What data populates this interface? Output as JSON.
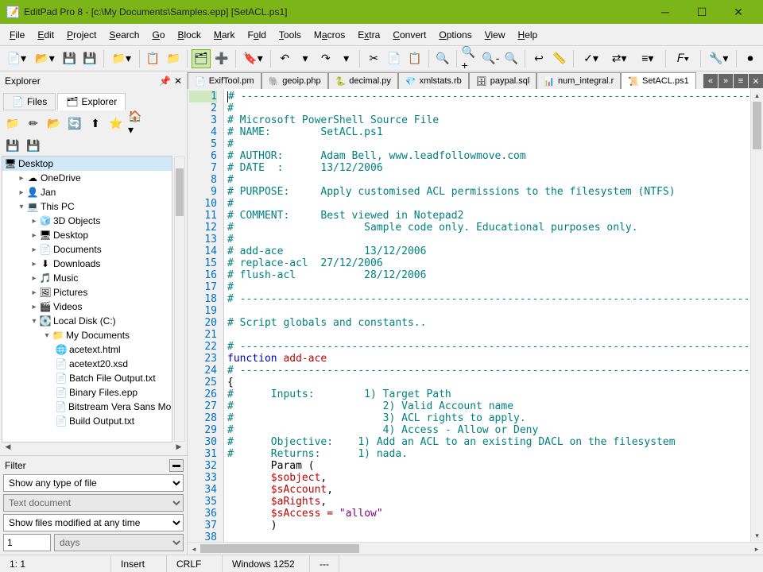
{
  "title": "EditPad Pro 8 - [c:\\My Documents\\Samples.epp] [SetACL.ps1]",
  "menu": [
    "File",
    "Edit",
    "Project",
    "Search",
    "Go",
    "Block",
    "Mark",
    "Fold",
    "Tools",
    "Macros",
    "Extra",
    "Convert",
    "Options",
    "View",
    "Help"
  ],
  "explorer": {
    "title": "Explorer",
    "tabs": {
      "files": "Files",
      "explorer": "Explorer"
    },
    "tree": {
      "n0": "Desktop",
      "n1": "OneDrive",
      "n2": "Jan",
      "n3": "This PC",
      "n4": "3D Objects",
      "n5": "Desktop",
      "n6": "Documents",
      "n7": "Downloads",
      "n8": "Music",
      "n9": "Pictures",
      "n10": "Videos",
      "n11": "Local Disk (C:)",
      "n12": "My Documents",
      "n13": "acetext.html",
      "n14": "acetext20.xsd",
      "n15": "Batch File Output.txt",
      "n16": "Binary Files.epp",
      "n17": "Bitstream Vera Sans Mono",
      "n18": "Build Output.txt"
    },
    "filter": {
      "label": "Filter",
      "type": "Show any type of file",
      "doc": "Text document",
      "modified": "Show files modified at any time",
      "num": "1",
      "unit": "days"
    }
  },
  "tabs": {
    "t0": "ExifTool.pm",
    "t1": "geoip.php",
    "t2": "decimal.py",
    "t3": "xmlstats.rb",
    "t4": "paypal.sql",
    "t5": "num_integral.r",
    "t6": "SetACL.ps1"
  },
  "code": {
    "l1": "# -------------------------------------------------------------------------------------------",
    "l2": "#",
    "l3": "# Microsoft PowerShell Source File",
    "l4": "# NAME:        SetACL.ps1",
    "l5": "#",
    "l6": "# AUTHOR:      Adam Bell, www.leadfollowmove.com",
    "l7": "# DATE  :      13/12/2006",
    "l8": "#",
    "l9": "# PURPOSE:     Apply customised ACL permissions to the filesystem (NTFS)",
    "l10": "#",
    "l11": "# COMMENT:     Best viewed in Notepad2",
    "l12": "#                     Sample code only. Educational purposes only.",
    "l13": "#",
    "l14": "# add-ace             13/12/2006",
    "l15": "# replace-acl  27/12/2006",
    "l16": "# flush-acl           28/12/2006",
    "l17": "#",
    "l18": "# -------------------------------------------------------------------------------------------",
    "l20": "# Script globals and constants..",
    "l22": "# -------------------------------------------------------------------------------------------",
    "l23a": "function",
    "l23b": " add-ace",
    "l24": "# -------------------------------------------------------------------------------------------",
    "l25": "{",
    "l26": "#      Inputs:        1) Target Path",
    "l27": "#                        2) Valid Account name",
    "l28": "#                        3) ACL rights to apply.",
    "l29": "#                        4) Access - Allow or Deny",
    "l30": "#      Objective:    1) Add an ACL to an existing DACL on the filesystem",
    "l31": "#      Returns:      1) nada.",
    "l32": "       Param (",
    "l33a": "       ",
    "l33b": "$sobject",
    "l33c": ",",
    "l34a": "       ",
    "l34b": "$sAccount",
    "l34c": ",",
    "l35a": "       ",
    "l35b": "$aRights",
    "l35c": ",",
    "l36a": "       ",
    "l36b": "$sAccess",
    "l36c": " = ",
    "l36d": "\"allow\"",
    "l37": "       )"
  },
  "status": {
    "pos": "1: 1",
    "mode": "Insert",
    "eol": "CRLF",
    "encoding": "Windows 1252",
    "extra": "---"
  }
}
